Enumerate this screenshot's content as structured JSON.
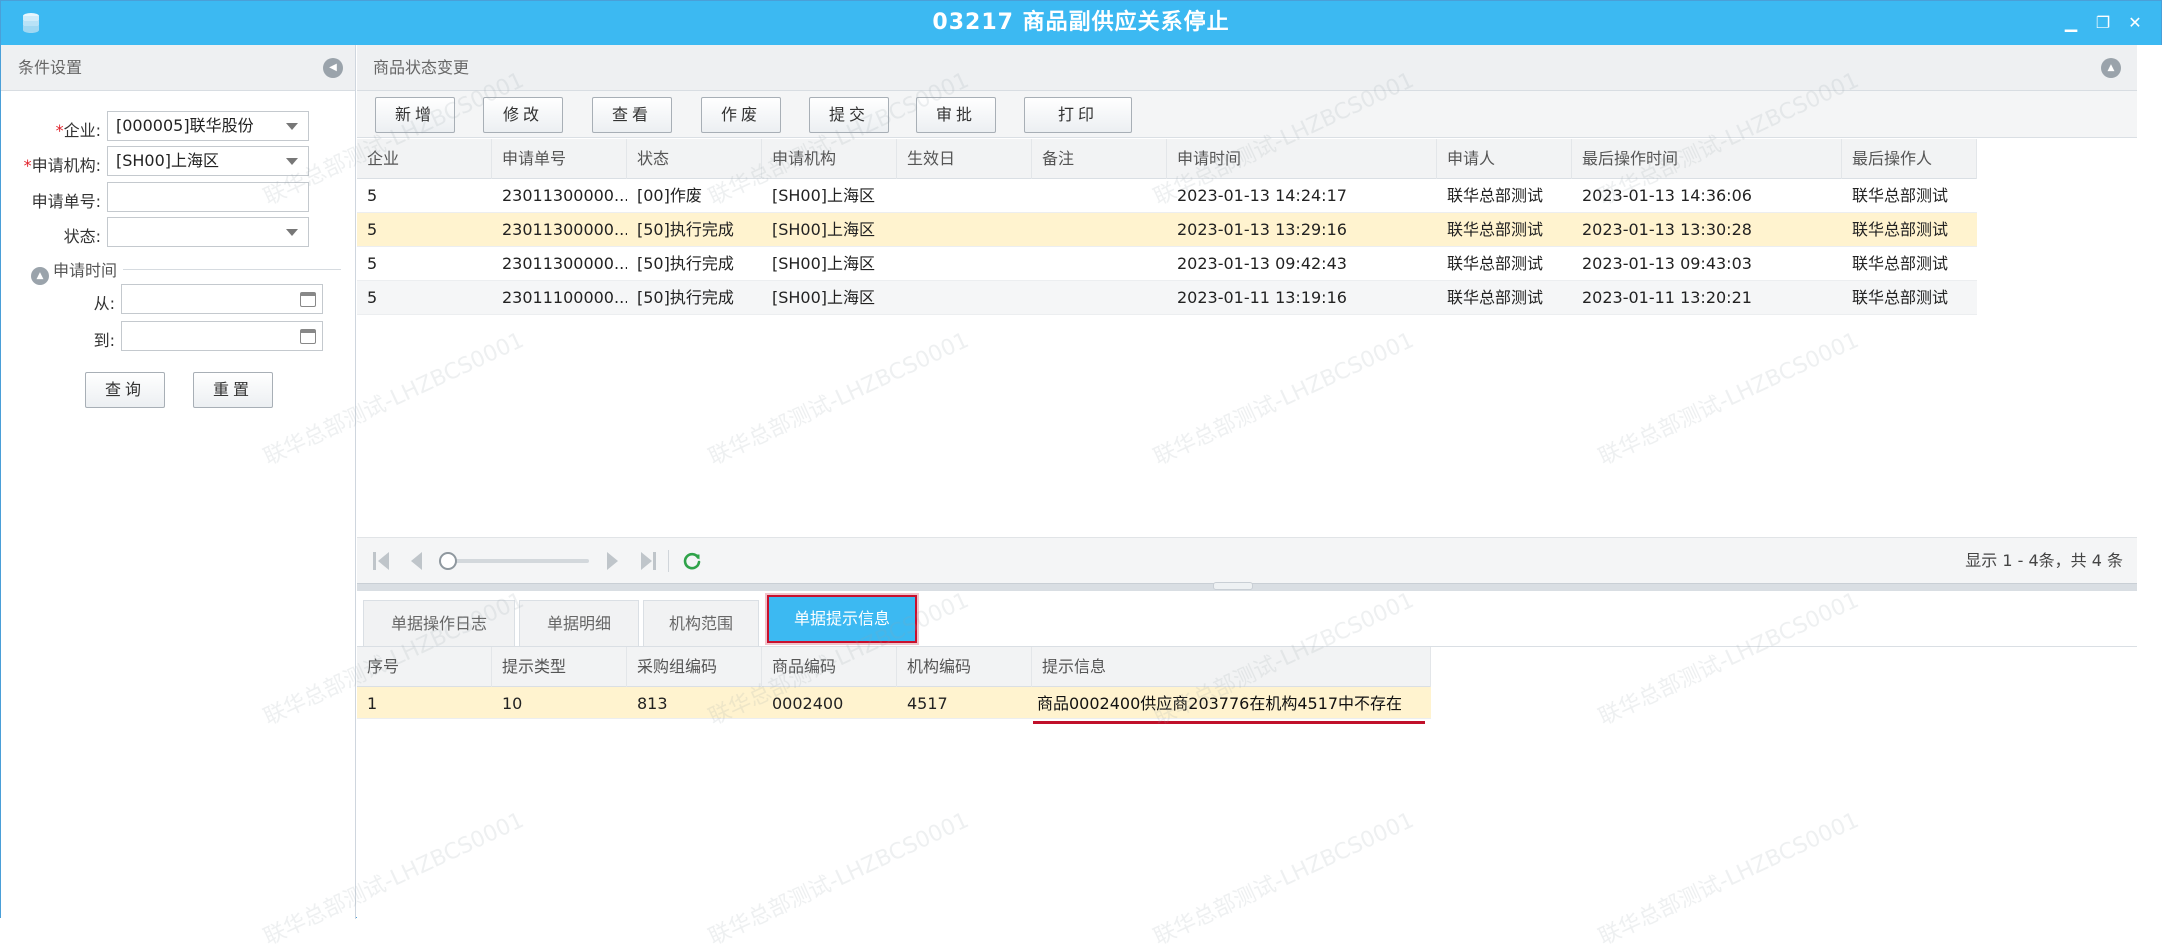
{
  "window": {
    "title": "03217 商品副供应关系停止",
    "minimize_glyph": "▁",
    "restore_glyph": "❐",
    "close_glyph": "✕"
  },
  "left_panel": {
    "header": "条件设置",
    "fields": {
      "company": {
        "label": "企业:",
        "value": "[000005]联华股份",
        "required": true
      },
      "org": {
        "label": "申请机构:",
        "value": "[SH00]上海区",
        "required": true
      },
      "request_no": {
        "label": "申请单号:",
        "value": ""
      },
      "status": {
        "label": "状态:",
        "value": ""
      }
    },
    "group": {
      "label": "申请时间",
      "from_label": "从:",
      "to_label": "到:",
      "from_value": "",
      "to_value": ""
    },
    "buttons": {
      "query": "查询",
      "reset": "重置"
    },
    "required_mark": "*"
  },
  "right_panel": {
    "header": "商品状态变更",
    "toolbar": [
      "新增",
      "修改",
      "查看",
      "作废",
      "提交",
      "审批",
      "打印"
    ],
    "grid": {
      "columns": [
        "企业",
        "申请单号",
        "状态",
        "申请机构",
        "生效日",
        "备注",
        "申请时间",
        "申请人",
        "最后操作时间",
        "最后操作人"
      ],
      "rows": [
        [
          "5",
          "23011300000...",
          "[00]作废",
          "[SH00]上海区",
          "",
          "",
          "2023-01-13 14:24:17",
          "联华总部测试",
          "2023-01-13 14:36:06",
          "联华总部测试"
        ],
        [
          "5",
          "23011300000...",
          "[50]执行完成",
          "[SH00]上海区",
          "",
          "",
          "2023-01-13 13:29:16",
          "联华总部测试",
          "2023-01-13 13:30:28",
          "联华总部测试"
        ],
        [
          "5",
          "23011300000...",
          "[50]执行完成",
          "[SH00]上海区",
          "",
          "",
          "2023-01-13 09:42:43",
          "联华总部测试",
          "2023-01-13 09:43:03",
          "联华总部测试"
        ],
        [
          "5",
          "23011100000...",
          "[50]执行完成",
          "[SH00]上海区",
          "",
          "",
          "2023-01-11 13:19:16",
          "联华总部测试",
          "2023-01-11 13:20:21",
          "联华总部测试"
        ]
      ],
      "selected_row": 1
    },
    "pager": {
      "summary": "显示 1 - 4条，共 4 条"
    },
    "tabs": [
      "单据操作日志",
      "单据明细",
      "机构范围",
      "单据提示信息"
    ],
    "active_tab": 3,
    "detail_grid": {
      "columns": [
        "序号",
        "提示类型",
        "采购组编码",
        "商品编码",
        "机构编码",
        "提示信息"
      ],
      "rows": [
        [
          "1",
          "10",
          "813",
          "0002400",
          "4517",
          "商品0002400供应商203776在机构4517中不存在"
        ]
      ]
    }
  },
  "watermark_text": "联华总部测试-LHZBCS0001",
  "colors": {
    "accent": "#3cb9f2",
    "selected_row": "#fff3cf",
    "highlight_border": "#c8102e"
  }
}
